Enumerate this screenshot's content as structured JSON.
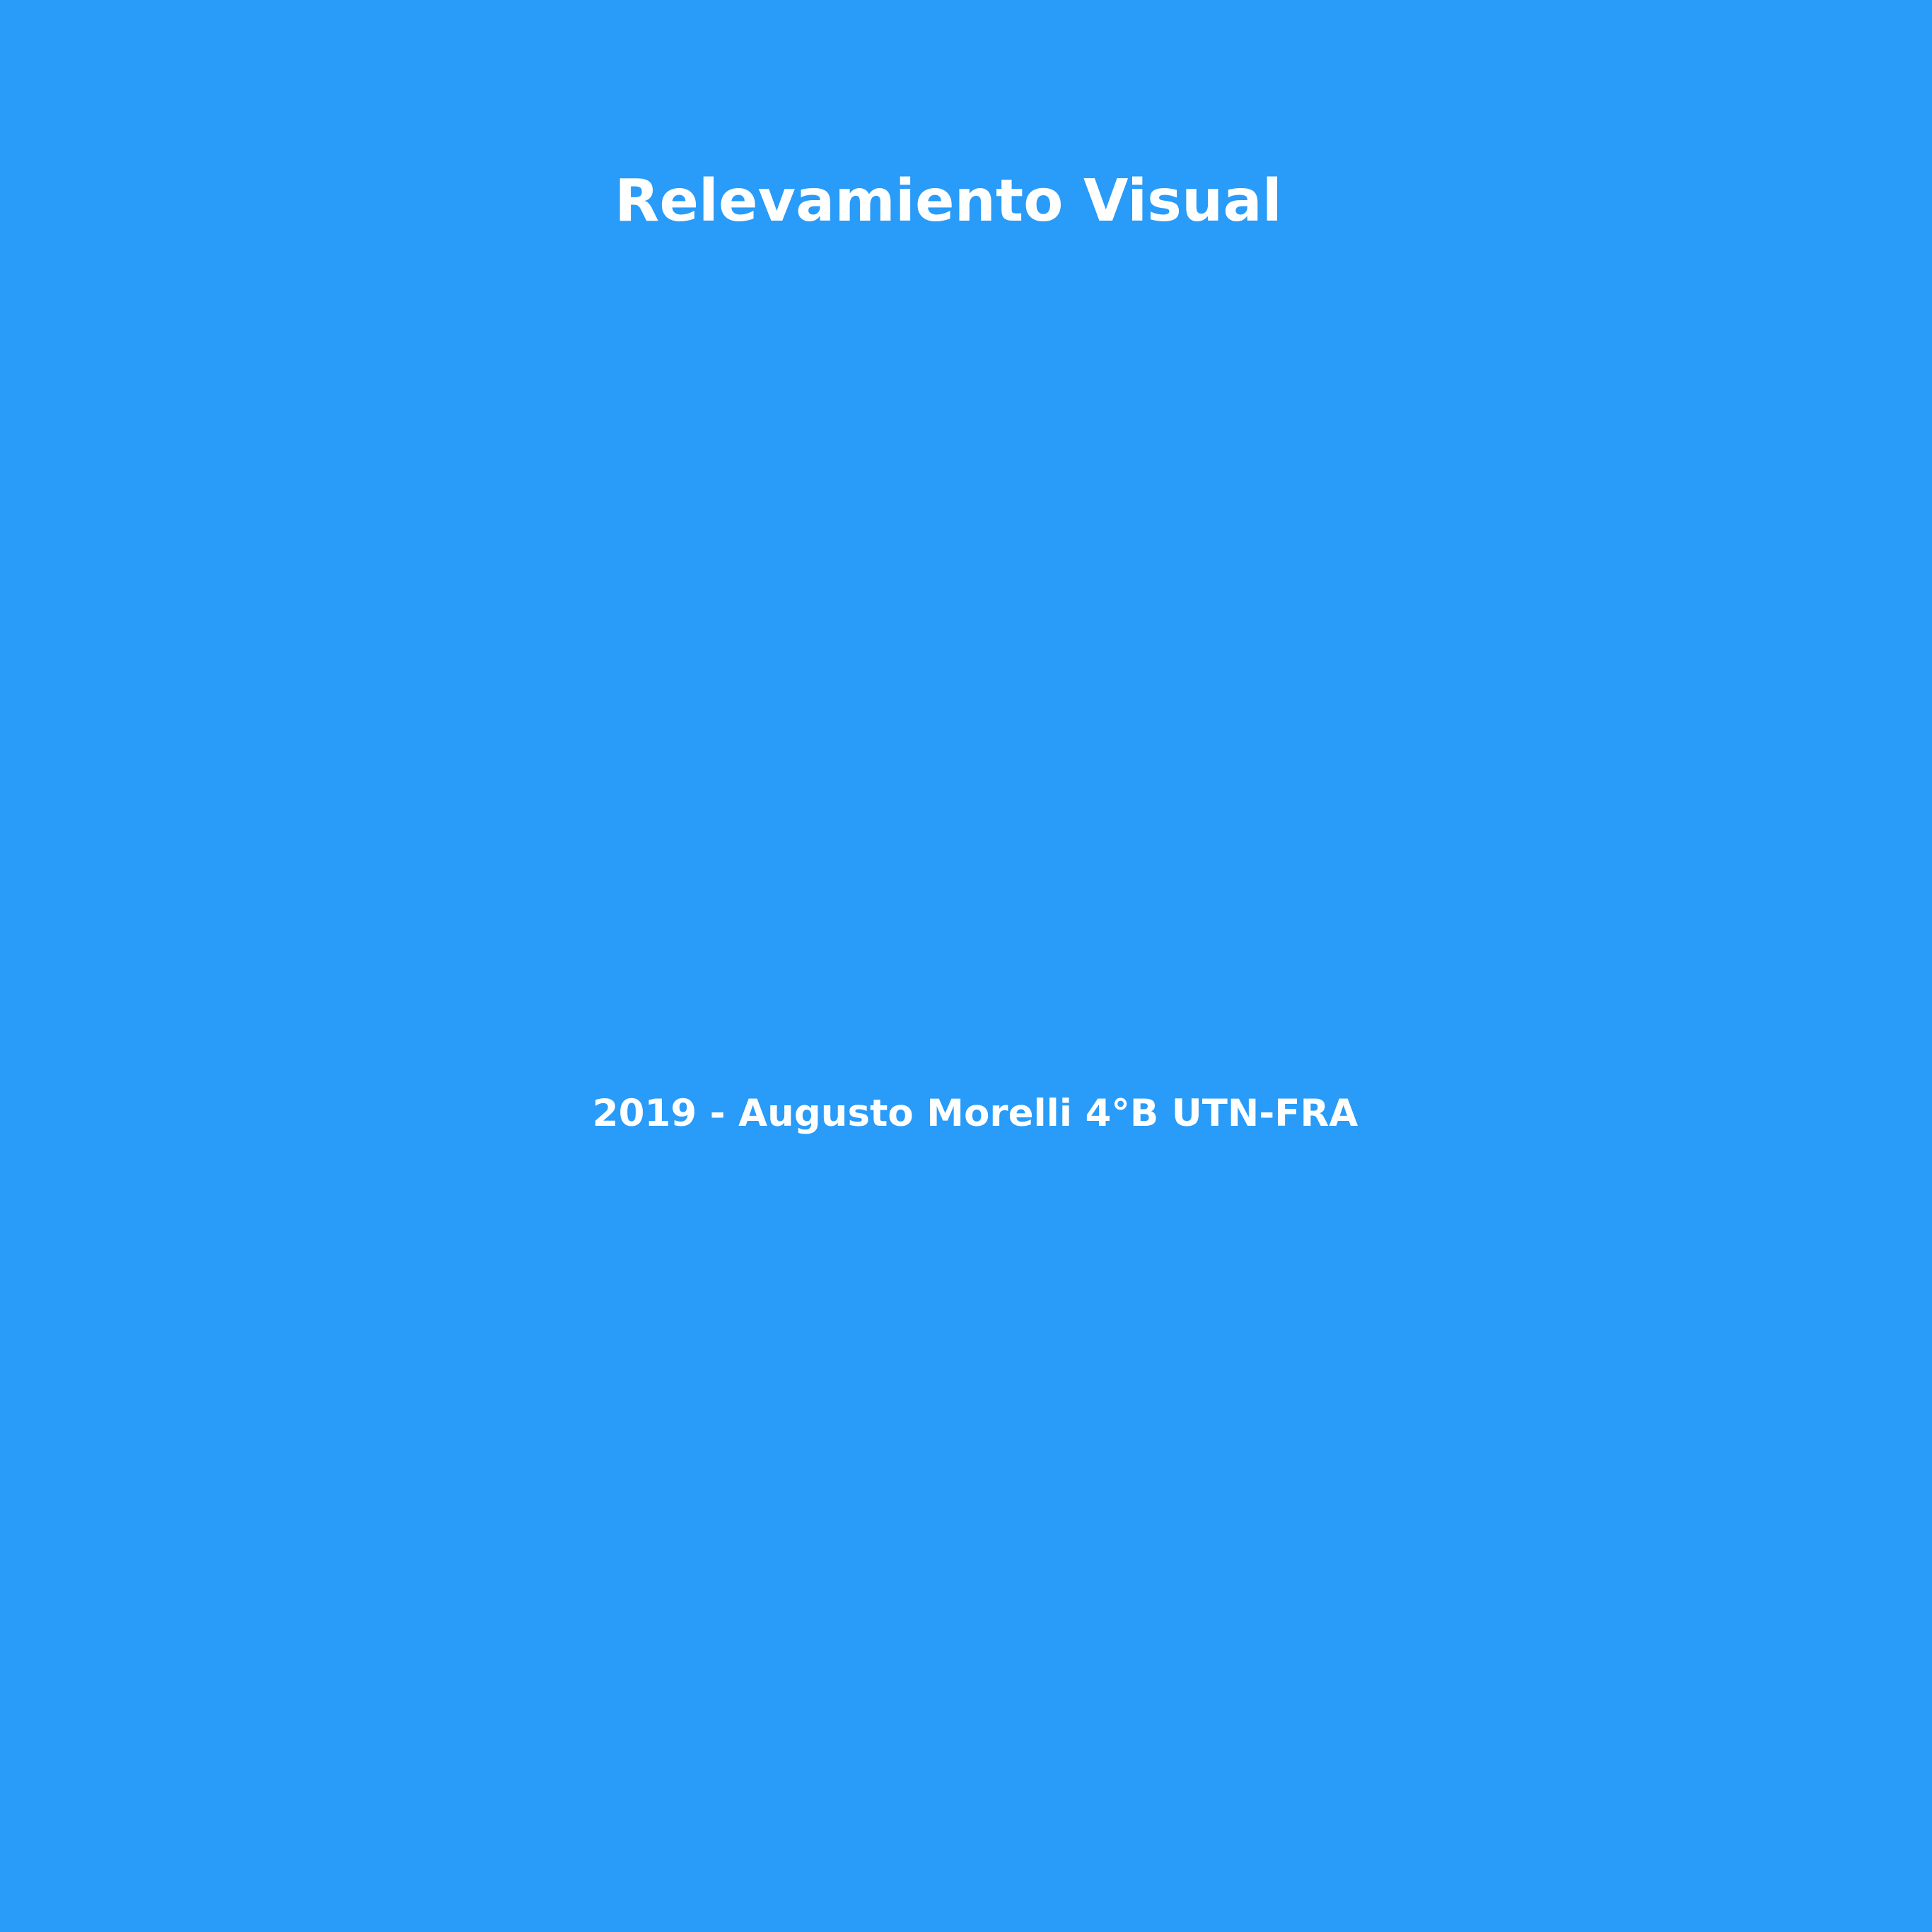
{
  "splash": {
    "title": "Relevamiento Visual",
    "credits": "2019 - Augusto Morelli 4°B UTN-FRA"
  },
  "colors": {
    "background": "#299bf8",
    "text": "#ffffff"
  }
}
